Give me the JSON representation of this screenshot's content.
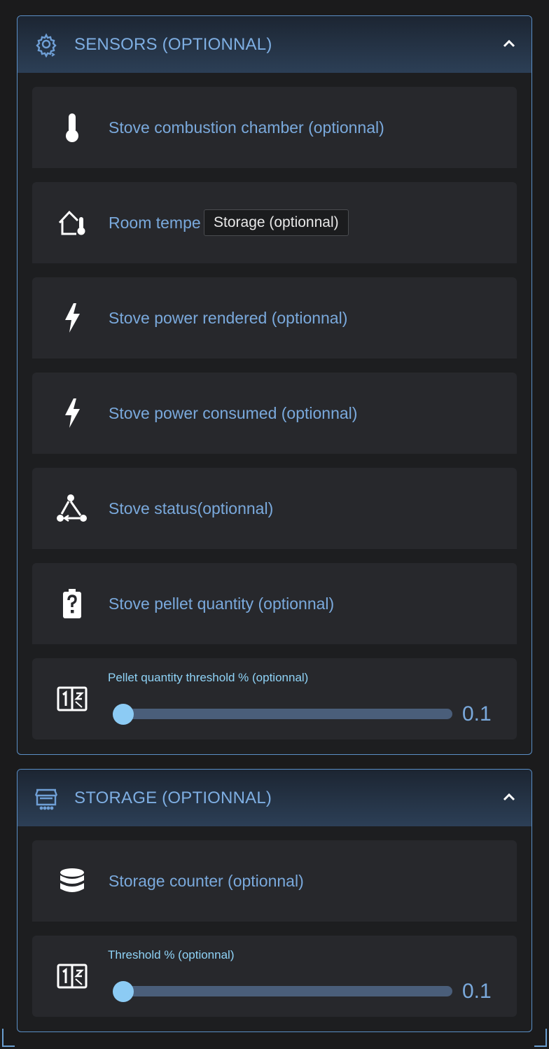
{
  "sensors": {
    "title": "SENSORS (OPTIONNAL)",
    "header_icon": "cog-sync-icon",
    "items": [
      {
        "label": "Stove combustion chamber (optionnal)",
        "icon": "thermometer-icon"
      },
      {
        "label": "Room tempe",
        "icon": "home-thermometer-icon"
      },
      {
        "label": "Stove power rendered (optionnal)",
        "icon": "lightning-bolt-icon"
      },
      {
        "label": "Stove power consumed (optionnal)",
        "icon": "lightning-bolt-icon"
      },
      {
        "label": "Stove status(optionnal)",
        "icon": "state-machine-icon"
      },
      {
        "label": "Stove pellet quantity (optionnal)",
        "icon": "battery-unknown-icon"
      }
    ],
    "slider": {
      "label": "Pellet quantity threshold % (optionnal)",
      "value": "0.1",
      "icon": "fraction-icon"
    }
  },
  "storage": {
    "title": "STORAGE (OPTIONNAL)",
    "header_icon": "storefront-icon",
    "items": [
      {
        "label": "Storage counter (optionnal)",
        "icon": "database-icon"
      }
    ],
    "slider": {
      "label": "Threshold % (optionnal)",
      "value": "0.1",
      "icon": "fraction-icon"
    }
  },
  "tooltip": {
    "text": "Storage (optionnal)"
  },
  "colors": {
    "accent": "#7eaee2",
    "border": "#5b8fc6",
    "slider_thumb": "#8ccbf4",
    "row_bg": "#27282c"
  }
}
